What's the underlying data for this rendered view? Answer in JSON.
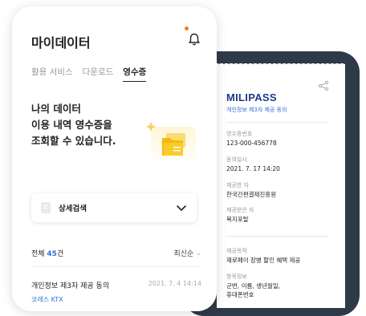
{
  "app": {
    "title": "마이데이터",
    "tabs": [
      {
        "label": "활용 서비스",
        "active": false
      },
      {
        "label": "다운로드",
        "active": false
      },
      {
        "label": "영수증",
        "active": true
      }
    ]
  },
  "hero": {
    "lines": [
      "나의 데이터",
      "이용 내역 영수증을",
      "조회할 수 있습니다."
    ]
  },
  "search": {
    "label": "상세검색"
  },
  "list": {
    "count_prefix": "전체 ",
    "count_number": "45",
    "count_suffix": "건",
    "sort_label": "최신순",
    "items": [
      {
        "title": "개인정보 제3자 제공 동의",
        "date": "2021. 7. 4  14:14",
        "sub": "코레스 KTX"
      }
    ]
  },
  "receipt": {
    "brand": "MILIPASS",
    "subtitle": "개인정보 제3자 제공 동의",
    "fields": [
      {
        "label": "영수증번호",
        "value": "123-000-456778"
      },
      {
        "label": "동의일시",
        "value": "2021. 7. 17 14:20"
      },
      {
        "label": "제공한 자",
        "value": "한국간편결제진흥원"
      },
      {
        "label": "제공받은 자",
        "value": "복지포탈"
      },
      {
        "label": "제공목적",
        "value": "제로페이 장병 할인 혜택 제공"
      },
      {
        "label": "항목정보",
        "value": "군번, 이름, 생년월일,"
      },
      {
        "label": "",
        "value": "휴대폰번호"
      }
    ]
  },
  "colors": {
    "accent_blue": "#2f6fd6",
    "brand_navy": "#1f3a8a",
    "back_phone": "#2f3a48",
    "notification_dot": "#f07a2a",
    "folder_yellow": "#f5c518"
  },
  "icons": [
    "bell-icon",
    "share-icon",
    "folder-icon",
    "document-icon",
    "chevron-down-icon"
  ]
}
